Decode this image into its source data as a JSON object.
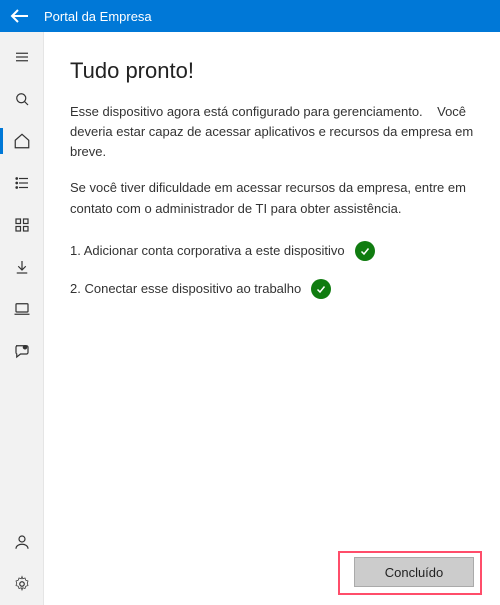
{
  "titlebar": {
    "app_title": "Portal da Empresa"
  },
  "sidebar": {
    "items": [
      {
        "name": "menu-icon"
      },
      {
        "name": "search-icon"
      },
      {
        "name": "home-icon",
        "selected": true
      },
      {
        "name": "list-icon"
      },
      {
        "name": "apps-grid-icon"
      },
      {
        "name": "download-icon"
      },
      {
        "name": "device-icon"
      },
      {
        "name": "support-icon"
      }
    ],
    "bottom_items": [
      {
        "name": "profile-icon"
      },
      {
        "name": "settings-icon"
      }
    ]
  },
  "main": {
    "heading": "Tudo pronto!",
    "paragraph1_a": "Esse dispositivo agora está configurado para gerenciamento.",
    "paragraph1_b": "Você deveria estar capaz de acessar aplicativos e recursos da empresa em breve.",
    "paragraph2_a": "Se você tiver dificuldade em acessar recursos da empresa, entre em contato",
    "paragraph2_b": "com o administrador de TI para obter assistência.",
    "steps": [
      {
        "num": "1.",
        "text": "Adicionar conta corporativa a este dispositivo",
        "done": true
      },
      {
        "num": "2.",
        "text": "Conectar esse dispositivo ao trabalho",
        "done": true
      }
    ],
    "done_button": "Concluído"
  }
}
